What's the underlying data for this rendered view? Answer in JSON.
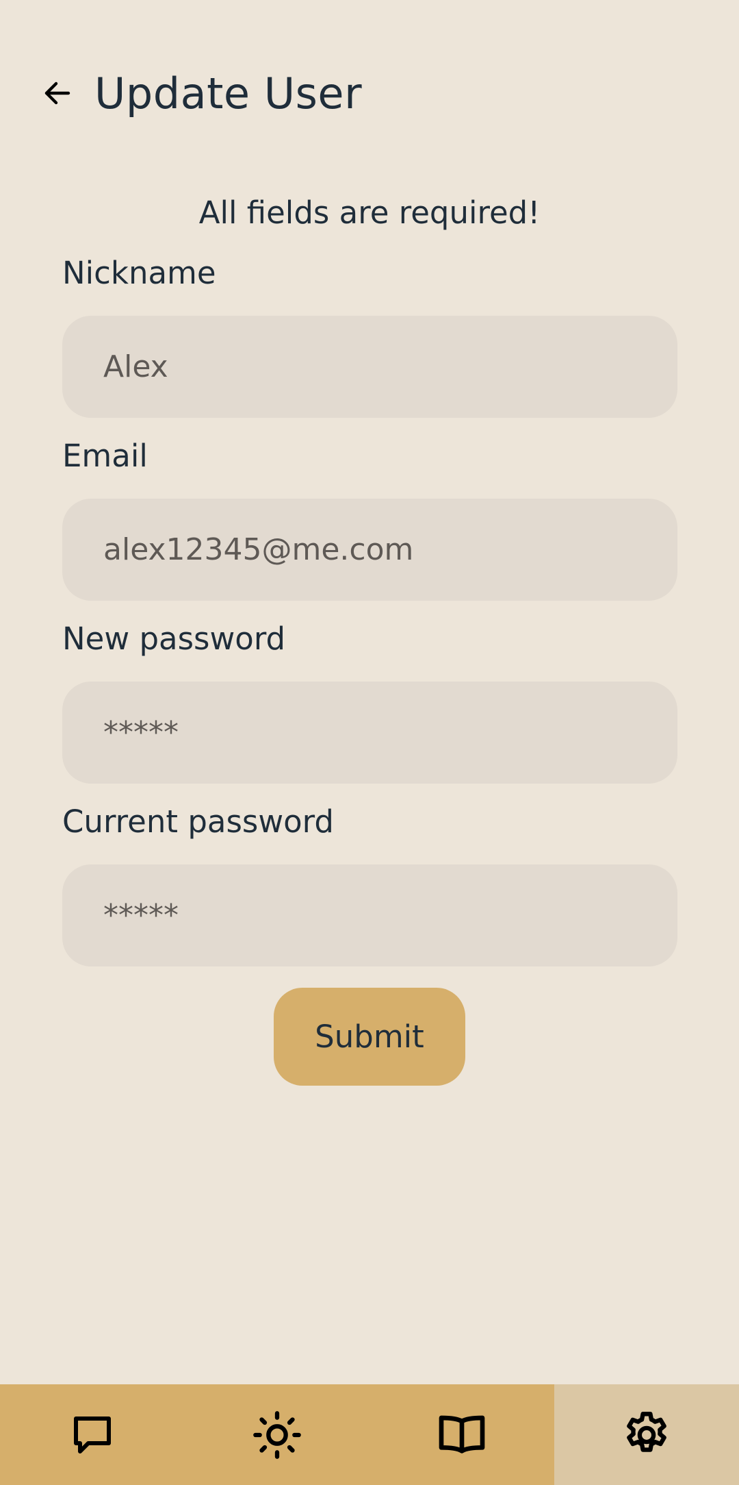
{
  "header": {
    "back_icon": "arrow-left-icon",
    "title": "Update User"
  },
  "notice": "All fields are required!",
  "form": {
    "nickname": {
      "label": "Nickname",
      "value": "Alex"
    },
    "email": {
      "label": "Email",
      "value": "alex12345@me.com"
    },
    "new_password": {
      "label": "New password",
      "value": "*****"
    },
    "current_password": {
      "label": "Current password",
      "value": "*****"
    },
    "submit_label": "Submit"
  },
  "nav": {
    "items": [
      {
        "icon": "chat-icon",
        "active": false
      },
      {
        "icon": "sun-icon",
        "active": false
      },
      {
        "icon": "book-icon",
        "active": false
      },
      {
        "icon": "gear-icon",
        "active": true
      }
    ]
  },
  "colors": {
    "background": "#EDE5D9",
    "input_background": "#E2DAD0",
    "accent": "#D6AF6B",
    "active_nav": "#DBC7A4",
    "text": "#1F2D3A"
  }
}
